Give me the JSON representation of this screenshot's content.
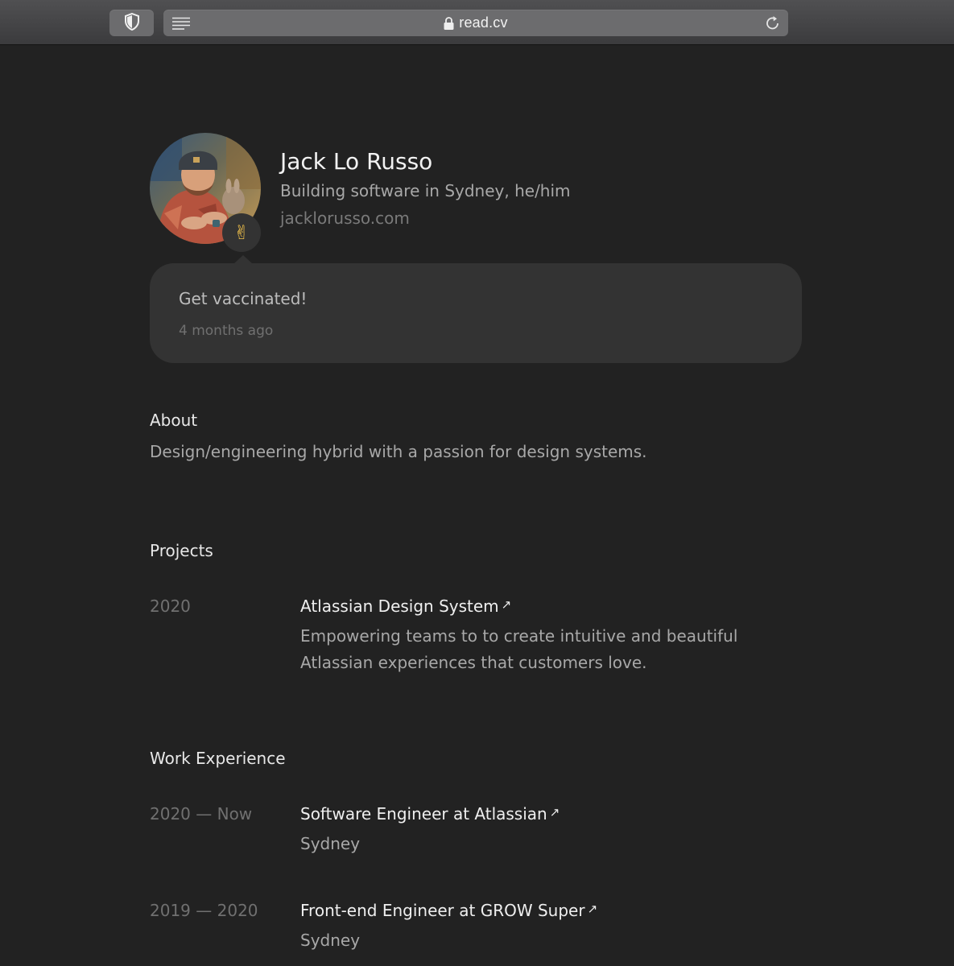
{
  "browser": {
    "url": "read.cv"
  },
  "profile": {
    "name": "Jack Lo Russo",
    "tagline": "Building software in Sydney, he/him",
    "website": "jacklorusso.com",
    "status_emoji": "✌",
    "status_text": "Get vaccinated!",
    "status_time": "4 months ago"
  },
  "about": {
    "heading": "About",
    "text": "Design/engineering hybrid with a passion for design systems."
  },
  "projects": {
    "heading": "Projects",
    "items": [
      {
        "year": "2020",
        "title": "Atlassian Design System",
        "description_line1": "Empowering teams to to create intuitive and beautiful",
        "description_line2": "Atlassian experiences that customers love."
      }
    ]
  },
  "work": {
    "heading": "Work Experience",
    "items": [
      {
        "dates": "2020 — Now",
        "title": "Software Engineer at Atlassian",
        "location": "Sydney"
      },
      {
        "dates": "2019 — 2020",
        "title": "Front-end Engineer at GROW Super",
        "location": "Sydney"
      }
    ]
  },
  "icons": {
    "external": "↗"
  }
}
